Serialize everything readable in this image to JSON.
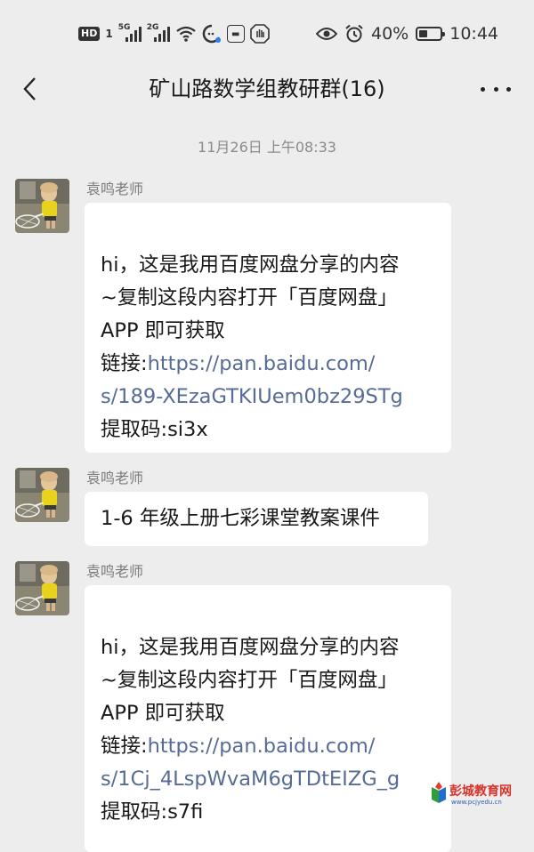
{
  "status_bar": {
    "hd": "HD",
    "sim": "1",
    "net1": "5G",
    "net2": "2G",
    "battery_percent": "40%",
    "battery_level": 0.4,
    "time": "10:44"
  },
  "nav": {
    "title": "矿山路数学组教研群(16)"
  },
  "timestamp": "11月26日 上午08:33",
  "messages": [
    {
      "sender": "袁鸣老师",
      "lines": [
        "hi，这是我用百度网盘分享的内容",
        "~复制这段内容打开「百度网盘」",
        "APP 即可获取"
      ],
      "link_prefix": "链接:",
      "link_1": "https://pan.baidu.com/",
      "link_2": "s/189-XEzaGTKIUem0bz29STg",
      "code": "提取码:si3x"
    },
    {
      "sender": "袁鸣老师",
      "text": "1-6 年级上册七彩课堂教案课件"
    },
    {
      "sender": "袁鸣老师",
      "lines": [
        "hi，这是我用百度网盘分享的内容",
        "~复制这段内容打开「百度网盘」",
        "APP 即可获取"
      ],
      "link_prefix": "链接:",
      "link_1": "https://pan.baidu.com/",
      "link_2": "s/1Cj_4LspWvaM6gTDtEIZG_g",
      "code": "提取码:s7fi"
    }
  ],
  "watermark": {
    "name": "彭城教育网",
    "url": "www.pcjyedu.cn"
  },
  "colors": {
    "background": "#ededed",
    "bubble": "#ffffff",
    "link": "#576b95"
  }
}
